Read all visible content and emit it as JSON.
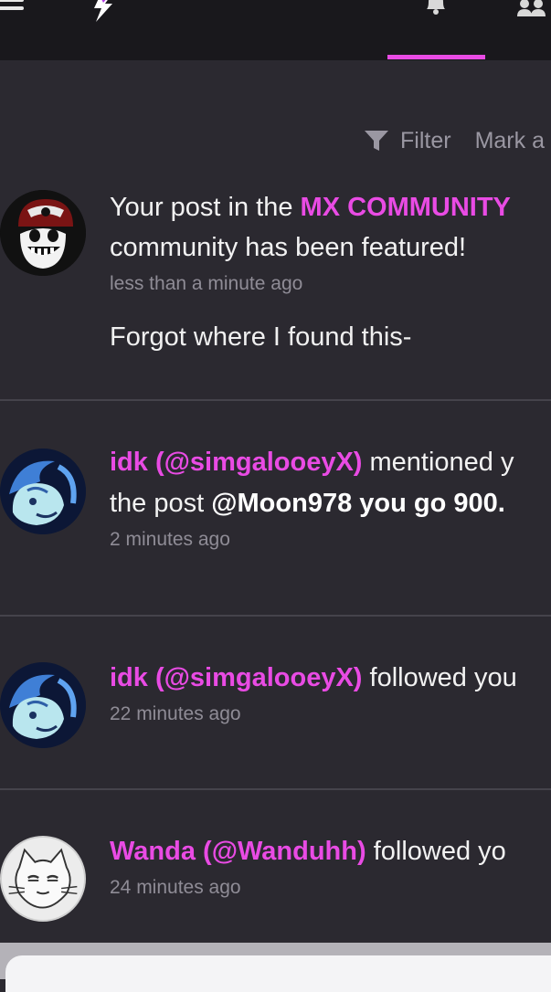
{
  "header": {
    "menu_icon": "hamburger-icon",
    "logo_icon": "lightning-bolt-icon",
    "notifications_icon": "bell-icon",
    "people_icon": "people-icon",
    "active_accent": "#e94be4"
  },
  "toolbar": {
    "filter_label": "Filter",
    "mark_label": "Mark a"
  },
  "notifications": [
    {
      "pre": "Your post in the ",
      "highlight": "MX COMMUNITY",
      "line2": "community has been featured!",
      "time": "less than a minute ago",
      "excerpt": "Forgot where I found this-"
    },
    {
      "highlight": "idk (@simgalooeyX)",
      "post": " mentioned y",
      "line2_pre": "the post ",
      "line2_bold": "@Moon978 you go 900.",
      "time": "2 minutes ago"
    },
    {
      "highlight": "idk (@simgalooeyX)",
      "post": " followed you",
      "time": "22 minutes ago"
    },
    {
      "highlight": "Wanda (@Wanduhh)",
      "post": " followed yo",
      "time": "24 minutes ago"
    }
  ],
  "colors": {
    "background": "#2b2930",
    "topbar": "#19181c",
    "highlight": "#e94be4",
    "muted": "#8f8c96"
  }
}
